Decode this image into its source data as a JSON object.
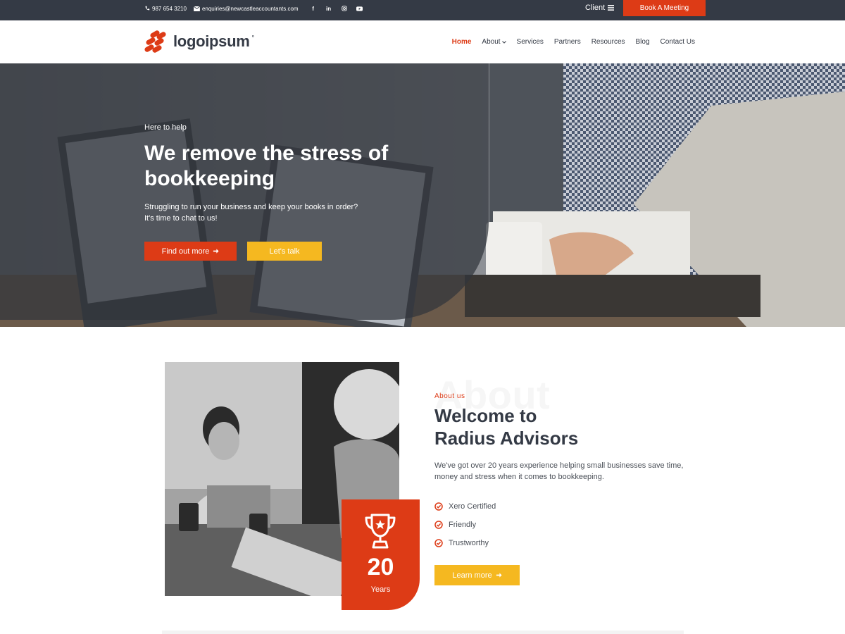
{
  "topbar": {
    "phone": "987 654 3210",
    "email": "enquiries@newcastleaccountants.com",
    "social_icons": [
      "facebook-icon",
      "linkedin-icon",
      "instagram-icon",
      "youtube-icon"
    ],
    "client_label": "Client",
    "book_button": "Book A Meeting"
  },
  "header": {
    "logo_text": "logoipsum",
    "logo_mark": "°",
    "nav": [
      {
        "label": "Home",
        "active": true
      },
      {
        "label": "About",
        "has_dropdown": true
      },
      {
        "label": "Services"
      },
      {
        "label": "Partners"
      },
      {
        "label": "Resources"
      },
      {
        "label": "Blog"
      },
      {
        "label": "Contact Us"
      }
    ]
  },
  "hero": {
    "eyebrow": "Here to help",
    "title": "We remove the stress of bookkeeping",
    "subtitle_line1": "Struggling to run your business and keep your books in order?",
    "subtitle_line2": "It's time to chat to us!",
    "primary_button": "Find out more",
    "secondary_button": "Let's talk"
  },
  "about": {
    "ghost_text": "About",
    "eyebrow": "About us",
    "title_line1": "Welcome to",
    "title_line2": "Radius Advisors",
    "text": "We've got over 20 years experience helping small businesses save time, money and stress when it comes to bookkeeping.",
    "checklist": [
      "Xero Certified",
      "Friendly",
      "Trustworthy"
    ],
    "button": "Learn more",
    "years_number": "20",
    "years_label": "Years"
  },
  "colors": {
    "brand_orange": "#dd3b16",
    "accent_yellow": "#f5b820",
    "dark": "#343a45"
  }
}
